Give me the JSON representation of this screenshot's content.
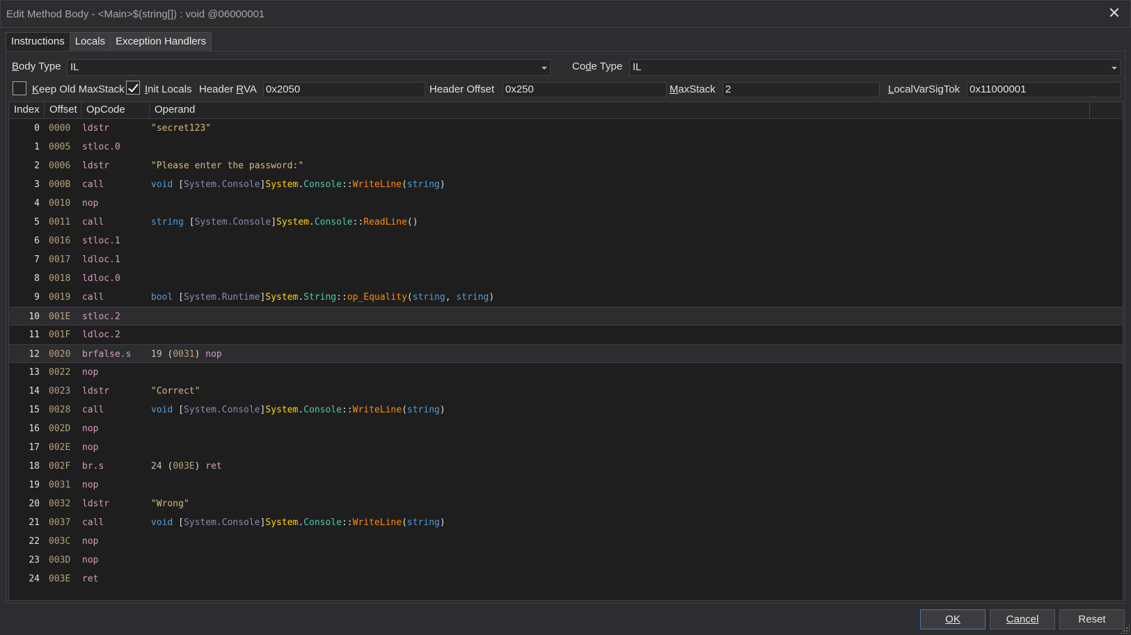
{
  "window": {
    "title": "Edit Method Body - <Main>$(string[]) : void @06000001"
  },
  "tabs": [
    {
      "label": "Instructions",
      "active": true
    },
    {
      "label": "Locals",
      "active": false
    },
    {
      "label": "Exception Handlers",
      "active": false
    }
  ],
  "body_type": {
    "label_accel": "B",
    "label_rest": "ody Type",
    "value": "IL"
  },
  "code_type": {
    "label_pre": "Co",
    "label_accel": "d",
    "label_post": "e Type",
    "value": "IL"
  },
  "options": {
    "keep_old_maxstack": {
      "label_accel": "K",
      "label_rest": "eep Old MaxStack",
      "checked": false
    },
    "init_locals": {
      "label_accel": "I",
      "label_rest": "nit Locals",
      "checked": true
    },
    "header_rva": {
      "label_pre": "Header ",
      "label_accel": "R",
      "label_post": "VA",
      "value": "0x2050"
    },
    "header_offset": {
      "label": "Header Offset",
      "value": "0x250"
    },
    "maxstack": {
      "label_accel": "M",
      "label_rest": "axStack",
      "value": "2"
    },
    "localvarsigtok": {
      "label_accel": "L",
      "label_rest": "ocalVarSigTok",
      "value": "0x11000001"
    }
  },
  "columns": [
    "Index",
    "Offset",
    "OpCode",
    "Operand"
  ],
  "instructions": [
    {
      "index": "0",
      "offset": "0000",
      "opcode": "ldstr",
      "operand": [
        [
          "s-str",
          "\"secret123\""
        ]
      ]
    },
    {
      "index": "1",
      "offset": "0005",
      "opcode": "stloc.0",
      "operand": []
    },
    {
      "index": "2",
      "offset": "0006",
      "opcode": "ldstr",
      "operand": [
        [
          "s-str",
          "\"Please enter the password:\""
        ]
      ]
    },
    {
      "index": "3",
      "offset": "000B",
      "opcode": "call",
      "operand": [
        [
          "s-kw",
          "void"
        ],
        [
          "s-punc",
          " ["
        ],
        [
          "s-asm",
          "System.Console"
        ],
        [
          "s-punc",
          "]"
        ],
        [
          "s-ns",
          "System"
        ],
        [
          "s-punc",
          "."
        ],
        [
          "s-type",
          "Console"
        ],
        [
          "s-sep",
          "::"
        ],
        [
          "s-meth",
          "WriteLine"
        ],
        [
          "s-punc",
          "("
        ],
        [
          "s-kw",
          "string"
        ],
        [
          "s-punc",
          ")"
        ]
      ]
    },
    {
      "index": "4",
      "offset": "0010",
      "opcode": "nop",
      "operand": []
    },
    {
      "index": "5",
      "offset": "0011",
      "opcode": "call",
      "operand": [
        [
          "s-kw",
          "string"
        ],
        [
          "s-punc",
          " ["
        ],
        [
          "s-asm",
          "System.Console"
        ],
        [
          "s-punc",
          "]"
        ],
        [
          "s-ns",
          "System"
        ],
        [
          "s-punc",
          "."
        ],
        [
          "s-type",
          "Console"
        ],
        [
          "s-sep",
          "::"
        ],
        [
          "s-meth",
          "ReadLine"
        ],
        [
          "s-punc",
          "()"
        ]
      ]
    },
    {
      "index": "6",
      "offset": "0016",
      "opcode": "stloc.1",
      "operand": []
    },
    {
      "index": "7",
      "offset": "0017",
      "opcode": "ldloc.1",
      "operand": []
    },
    {
      "index": "8",
      "offset": "0018",
      "opcode": "ldloc.0",
      "operand": []
    },
    {
      "index": "9",
      "offset": "0019",
      "opcode": "call",
      "operand": [
        [
          "s-kw",
          "bool"
        ],
        [
          "s-punc",
          " ["
        ],
        [
          "s-asm",
          "System.Runtime"
        ],
        [
          "s-punc",
          "]"
        ],
        [
          "s-ns",
          "System"
        ],
        [
          "s-punc",
          "."
        ],
        [
          "s-type",
          "String"
        ],
        [
          "s-sep",
          "::"
        ],
        [
          "s-meth",
          "op_Equality"
        ],
        [
          "s-punc",
          "("
        ],
        [
          "s-kw",
          "string"
        ],
        [
          "s-punc",
          ", "
        ],
        [
          "s-kw",
          "string"
        ],
        [
          "s-punc",
          ")"
        ]
      ]
    },
    {
      "index": "10",
      "offset": "001E",
      "opcode": "stloc.2",
      "operand": [],
      "selected": true
    },
    {
      "index": "11",
      "offset": "001F",
      "opcode": "ldloc.2",
      "operand": []
    },
    {
      "index": "12",
      "offset": "0020",
      "opcode": "brfalse.s",
      "operand": [
        [
          "s-num",
          "19"
        ],
        [
          "s-punc",
          " ("
        ],
        [
          "s-off",
          "0031"
        ],
        [
          "s-punc",
          ") "
        ],
        [
          "s-op",
          "nop"
        ]
      ],
      "selected": true
    },
    {
      "index": "13",
      "offset": "0022",
      "opcode": "nop",
      "operand": []
    },
    {
      "index": "14",
      "offset": "0023",
      "opcode": "ldstr",
      "operand": [
        [
          "s-str",
          "\"Correct\""
        ]
      ]
    },
    {
      "index": "15",
      "offset": "0028",
      "opcode": "call",
      "operand": [
        [
          "s-kw",
          "void"
        ],
        [
          "s-punc",
          " ["
        ],
        [
          "s-asm",
          "System.Console"
        ],
        [
          "s-punc",
          "]"
        ],
        [
          "s-ns",
          "System"
        ],
        [
          "s-punc",
          "."
        ],
        [
          "s-type",
          "Console"
        ],
        [
          "s-sep",
          "::"
        ],
        [
          "s-meth",
          "WriteLine"
        ],
        [
          "s-punc",
          "("
        ],
        [
          "s-kw",
          "string"
        ],
        [
          "s-punc",
          ")"
        ]
      ]
    },
    {
      "index": "16",
      "offset": "002D",
      "opcode": "nop",
      "operand": []
    },
    {
      "index": "17",
      "offset": "002E",
      "opcode": "nop",
      "operand": []
    },
    {
      "index": "18",
      "offset": "002F",
      "opcode": "br.s",
      "operand": [
        [
          "s-num",
          "24"
        ],
        [
          "s-punc",
          " ("
        ],
        [
          "s-off",
          "003E"
        ],
        [
          "s-punc",
          ") "
        ],
        [
          "s-op",
          "ret"
        ]
      ]
    },
    {
      "index": "19",
      "offset": "0031",
      "opcode": "nop",
      "operand": []
    },
    {
      "index": "20",
      "offset": "0032",
      "opcode": "ldstr",
      "operand": [
        [
          "s-str",
          "\"Wrong\""
        ]
      ]
    },
    {
      "index": "21",
      "offset": "0037",
      "opcode": "call",
      "operand": [
        [
          "s-kw",
          "void"
        ],
        [
          "s-punc",
          " ["
        ],
        [
          "s-asm",
          "System.Console"
        ],
        [
          "s-punc",
          "]"
        ],
        [
          "s-ns",
          "System"
        ],
        [
          "s-punc",
          "."
        ],
        [
          "s-type",
          "Console"
        ],
        [
          "s-sep",
          "::"
        ],
        [
          "s-meth",
          "WriteLine"
        ],
        [
          "s-punc",
          "("
        ],
        [
          "s-kw",
          "string"
        ],
        [
          "s-punc",
          ")"
        ]
      ]
    },
    {
      "index": "22",
      "offset": "003C",
      "opcode": "nop",
      "operand": []
    },
    {
      "index": "23",
      "offset": "003D",
      "opcode": "nop",
      "operand": []
    },
    {
      "index": "24",
      "offset": "003E",
      "opcode": "ret",
      "operand": []
    }
  ],
  "buttons": {
    "ok": {
      "label": "OK"
    },
    "cancel": {
      "label": "Cancel"
    },
    "reset": {
      "label": "Reset"
    }
  },
  "colors": {
    "accent": "#3d7ab8",
    "opcode": "#d69dc0",
    "offset": "#b5a07a",
    "string": "#d7ba7d",
    "keyword": "#569cd6"
  }
}
